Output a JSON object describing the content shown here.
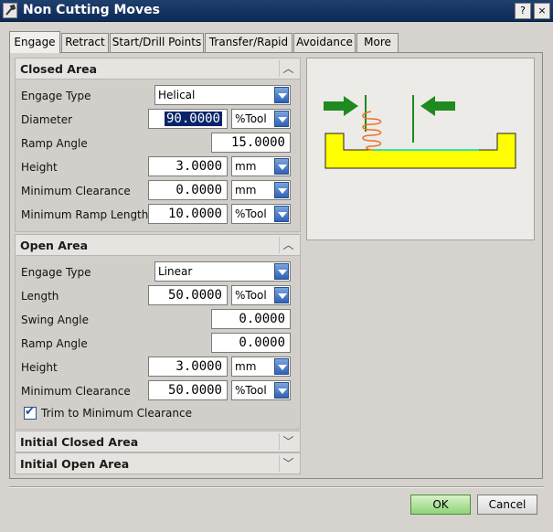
{
  "window": {
    "title": "Non Cutting Moves"
  },
  "tabs": [
    {
      "label": "Engage",
      "active": true
    },
    {
      "label": "Retract"
    },
    {
      "label": "Start/Drill Points"
    },
    {
      "label": "Transfer/Rapid"
    },
    {
      "label": "Avoidance"
    },
    {
      "label": "More"
    }
  ],
  "closed_area": {
    "title": "Closed Area",
    "engage_type": {
      "label": "Engage Type",
      "value": "Helical"
    },
    "diameter": {
      "label": "Diameter",
      "value": "90.0000",
      "unit": "%Tool"
    },
    "ramp_angle": {
      "label": "Ramp Angle",
      "value": "15.0000"
    },
    "height": {
      "label": "Height",
      "value": "3.0000",
      "unit": "mm"
    },
    "min_clearance": {
      "label": "Minimum Clearance",
      "value": "0.0000",
      "unit": "mm"
    },
    "min_ramp_length": {
      "label": "Minimum Ramp Length",
      "value": "10.0000",
      "unit": "%Tool"
    }
  },
  "open_area": {
    "title": "Open Area",
    "engage_type": {
      "label": "Engage Type",
      "value": "Linear"
    },
    "length": {
      "label": "Length",
      "value": "50.0000",
      "unit": "%Tool"
    },
    "swing_angle": {
      "label": "Swing Angle",
      "value": "0.0000"
    },
    "ramp_angle": {
      "label": "Ramp Angle",
      "value": "0.0000"
    },
    "height": {
      "label": "Height",
      "value": "3.0000",
      "unit": "mm"
    },
    "min_clearance": {
      "label": "Minimum Clearance",
      "value": "50.0000",
      "unit": "%Tool"
    },
    "trim_checkbox": {
      "label": "Trim to Minimum Clearance",
      "checked": true
    }
  },
  "initial_closed_area": {
    "title": "Initial Closed Area"
  },
  "initial_open_area": {
    "title": "Initial Open Area"
  },
  "buttons": {
    "ok": "OK",
    "cancel": "Cancel"
  },
  "colors": {
    "titlebar": "#0d2a56",
    "selection": "#0a246a",
    "preview_arrow": "#1f8a1f",
    "preview_part": "#ffff00",
    "preview_helix": "#e8722a",
    "preview_floor": "#35e0b0",
    "ok_button": "#8fd477"
  },
  "icons": {
    "app": "wrench-icon",
    "collapse": "chevron-up-icon",
    "expand": "chevron-down-icon",
    "window_help": "help-icon",
    "window_close": "close-icon",
    "dropdown": "dropdown-arrow-icon"
  }
}
